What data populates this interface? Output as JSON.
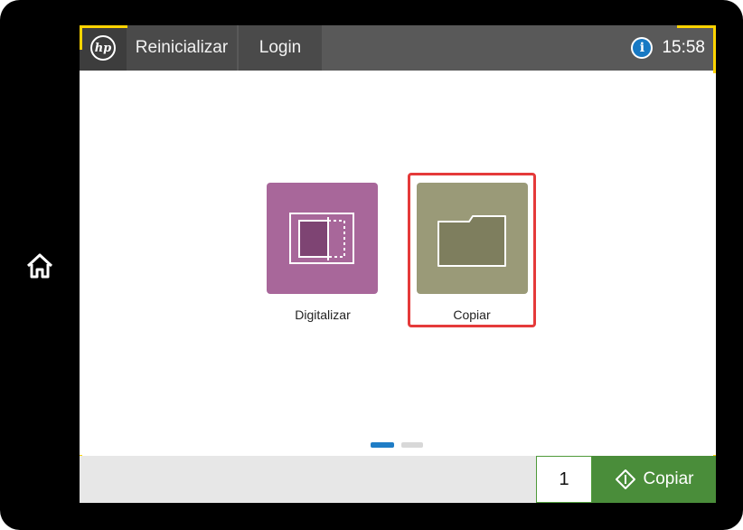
{
  "topbar": {
    "logo_text": "hp",
    "reset_label": "Reinicializar",
    "login_label": "Login",
    "info_symbol": "i",
    "time": "15:58"
  },
  "apps": [
    {
      "label": "Digitalizar",
      "icon": "scan-icon",
      "color": "#a8679a"
    },
    {
      "label": "Copiar",
      "icon": "folder-icon",
      "color": "#9a9a78",
      "selected": true
    }
  ],
  "pager": {
    "pages": 2,
    "current": 1
  },
  "bottombar": {
    "copies": "1",
    "start_label": "Copiar",
    "start_color": "#4a8d3a"
  },
  "colors": {
    "topbar": "#595959",
    "accent_corner": "#ffd400",
    "selection": "#e53a3a"
  }
}
